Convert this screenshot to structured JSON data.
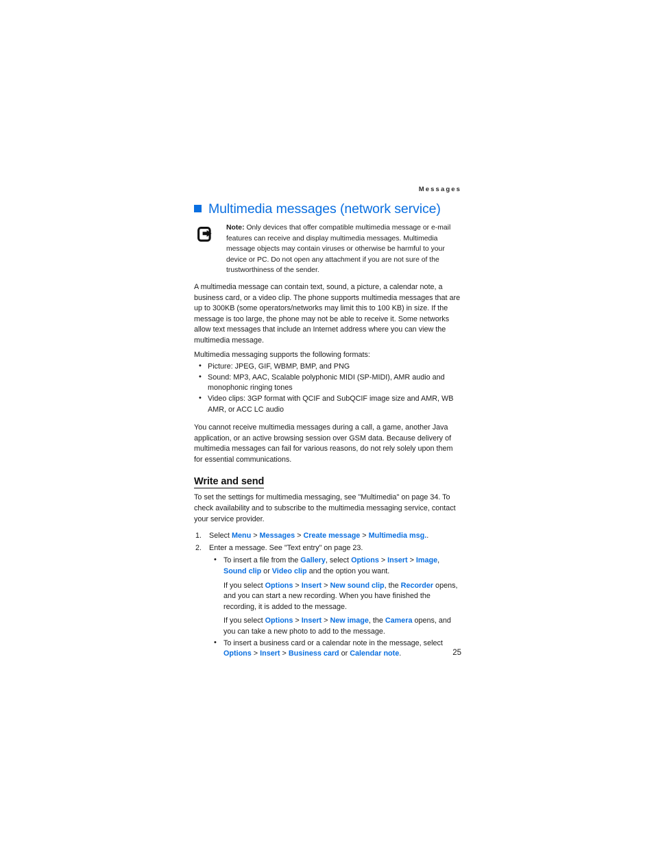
{
  "document": {
    "running_head": "Messages",
    "page_number": "25",
    "accent_color": "#0a6fe0",
    "text_color": "#1a1a1a"
  },
  "heading": {
    "bullet_icon": "square-bullet-icon",
    "title": "Multimedia messages (network service)"
  },
  "note": {
    "icon": "note-arrow-icon",
    "label": "Note:",
    "text": " Only devices that offer compatible multimedia message or e-mail features can receive and display multimedia messages. Multimedia message objects may contain viruses or otherwise be harmful to your device or PC. Do not open any attachment if you are not sure of the trustworthiness of the sender."
  },
  "paragraphs": {
    "intro": "A multimedia message can contain text, sound, a picture, a calendar note, a business card, or a video clip. The phone supports multimedia messages that are up to 300KB (some operators/networks may limit this to 100 KB) in size. If the message is too large, the phone may not be able to receive it. Some networks allow text messages that include an Internet address where you can view the multimedia message.",
    "formats_lead": "Multimedia messaging supports the following formats:",
    "cannot_receive": "You cannot receive multimedia messages during a call, a game, another Java application, or an active browsing session over GSM data. Because delivery of multimedia messages can fail for various reasons, do not rely solely upon them for essential communications."
  },
  "formats_list": [
    "Picture: JPEG, GIF, WBMP, BMP, and PNG",
    "Sound: MP3, AAC, Scalable polyphonic MIDI (SP-MIDI), AMR audio and monophonic ringing tones",
    "Video clips: 3GP format with QCIF and SubQCIF image size and AMR, WB AMR, or ACC LC audio"
  ],
  "section": {
    "title": "Write and send",
    "intro": "To set the settings for multimedia messaging, see \"Multimedia\" on page 34. To check availability and to subscribe to the multimedia messaging service, contact your service provider."
  },
  "steps": {
    "one": {
      "number": "1.",
      "prefix": "Select ",
      "links": {
        "menu": "Menu",
        "messages": "Messages",
        "create_message": "Create message",
        "multimedia_msg": "Multimedia msg."
      },
      "sep": " > "
    },
    "two": {
      "number": "2.",
      "text": "Enter a message. See \"Text entry\" on page 23."
    }
  },
  "sub_bullets": {
    "insert_file": {
      "part1": "To insert a file from the ",
      "gallery": "Gallery",
      "part2": ", select ",
      "options": "Options",
      "insert": "Insert",
      "image": "Image",
      "comma": ", ",
      "sound_clip": "Sound clip",
      "part3": " or ",
      "video_clip": "Video clip",
      "part4": " and the option you want.",
      "sep": " > "
    },
    "new_sound_clip": {
      "part1": "If you select ",
      "options": "Options",
      "insert": "Insert",
      "new_sound_clip": "New sound clip",
      "part2": ", the ",
      "recorder": "Recorder",
      "part3": " opens, and you can start a new recording. When you have finished the recording, it is added to the message.",
      "sep": " > "
    },
    "new_image": {
      "part1": "If you select ",
      "options": "Options",
      "insert": "Insert",
      "new_image": "New image",
      "part2": ", the ",
      "camera": "Camera",
      "part3": " opens, and you can take a new photo to add to the message.",
      "sep": " > "
    },
    "business_card": {
      "part1": "To insert a business card or a calendar note in the message, select ",
      "options": "Options",
      "insert": "Insert",
      "business_card": "Business card",
      "part2": " or ",
      "calendar_note": "Calendar note",
      "part3": ".",
      "sep": " > "
    }
  }
}
